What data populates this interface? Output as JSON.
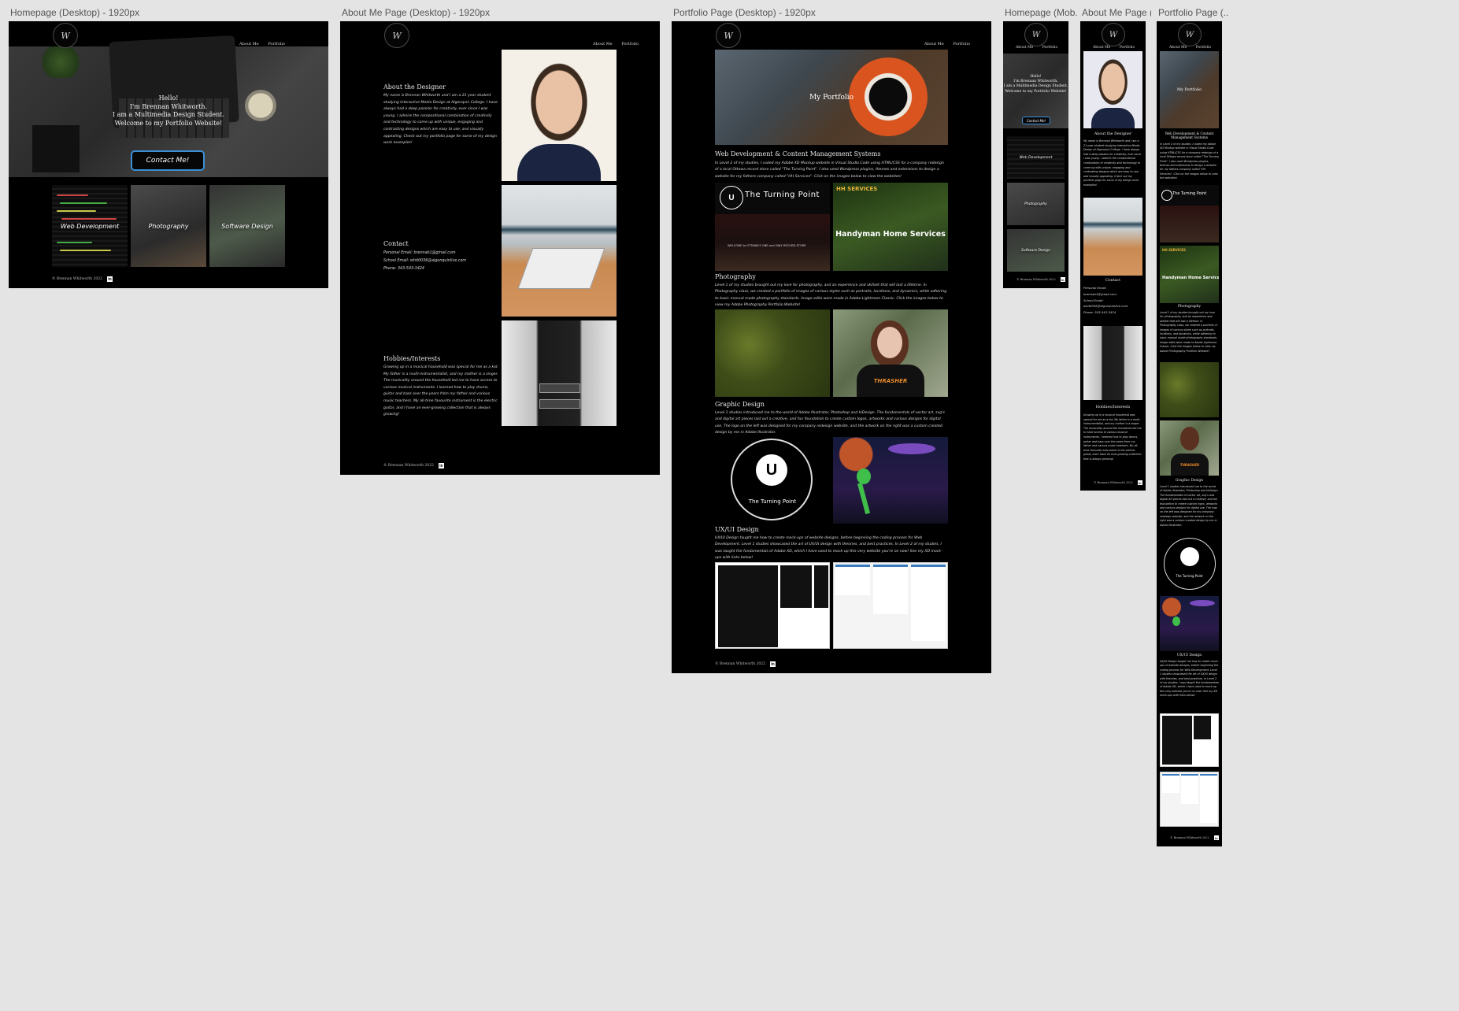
{
  "canvas": {
    "frames": [
      {
        "label": "Homepage (Desktop) - 1920px"
      },
      {
        "label": "About Me Page (Desktop) - 1920px"
      },
      {
        "label": "Portfolio Page (Desktop) - 1920px"
      },
      {
        "label": "Homepage (Mob..."
      },
      {
        "label": "About Me Page (..."
      },
      {
        "label": "Portfolio Page (..."
      }
    ]
  },
  "site": {
    "logo_text": "W",
    "nav": {
      "about": "About Me",
      "portfolio": "Portfolio"
    },
    "footer": {
      "copyright": "© Brennan Whitworth 2022",
      "linkedin": "in"
    }
  },
  "home": {
    "hero_lines": [
      "Hello!",
      "I'm Brennan Whitworth.",
      "I am a Multimedia Design Student.",
      "Welcome to my Portfolio Website!"
    ],
    "cta": "Contact Me!",
    "tiles": [
      "Web Development",
      "Photography",
      "Software Design"
    ]
  },
  "about": {
    "designer_title": "About the Designer",
    "designer_text": "My name is Brennan Whitworth and I am a 21-year student studying Interactive Media Design at Algonquin College. I have always had a deep passion for creativity, ever since I was young. I admire the compositional combination of creativity and technology to come up with unique, engaging and contrasting designs which are easy to use, and visually appealing. Check out my portfolio page for some of my design work examples!",
    "contact_title": "Contact",
    "contact_lines": [
      "Personal Email: brennab1@gmail.com",
      "School Email: whit0036@algonquinlive.com",
      "Phone: 343-543-3424"
    ],
    "hobbies_title": "Hobbies/Interests",
    "hobbies_text": "Growing up in a musical household was special for me as a kid. My father is a multi-instrumentalist, and my mother is a singer. The musicality around the household led me to have access to various musical instruments. I learned how to play drums, guitar and bass over the years from my father and various music teachers. My all-time favourite instrument is the electric guitar, and I have an ever-growing collection that is always growing!"
  },
  "portfolio": {
    "hero_title": "My Portfolio",
    "web_title": "Web Development & Content Management Systems",
    "web_text": "In Level 2 of my studies, I coded my Adobe XD Mockup website in Visual Studio Code using HTML/CSS for a company redesign of a local Ottawa record store called \"The Turning Point\". I also used Wordpress plugins, themes and extensions to design a website for my fathers company called \"HH Services\". Click on the images below to view the websites!",
    "turning_point": "The Turning Point",
    "tp_sub": "WELCOME to OTTAWA'S ONE and ONLY RECORD STORE",
    "hh_badge": "HH SERVICES",
    "hh_title": "Handyman Home Services",
    "photo_title": "Photography",
    "photo_text": "Level 1 of my studies brought out my love for photography, and an experience and skillset that will last a lifetime. In Photography class, we created a portfolio of images of various styles such as portraits, locations, and dynamics, while adhering to basic manual mode photography standards. Image edits were made in Adobe Lightroom Classic. Click the images below to view my Adobe Photography Portfolio Website!",
    "shirt_text": "THRASHER",
    "graphic_title": "Graphic Design",
    "graphic_text": "Level 1 studies introduced me to the world of Adobe Illustrator, Photoshop and InDesign. The fundamentals of vector art, svg's and digital art pieces laid out a creative, and fun foundation to create custom logos, artworks and various designs for digital use. The logo on the left was designed for my company redesign website, and the artwork on the right was a custom created design by me in Adobe Illustrator.",
    "ux_title": "UX/UI Design",
    "ux_text": "UX/UI Design taught me how to create mock-ups of website designs, before beginning the coding process for Web Development. Level 1 studies showcased the art of UX/UI design with theories, and best practices. In Level 2 of my studies, I was taught the fundamentals of Adobe XD, which I have used to mock-up this very website you're on now! See my XD mock-ups with links below!",
    "mobile_web_title": "Web Development & Content Management Systems"
  },
  "mobile_about": {
    "contact_lines": [
      "Personal Email:",
      "brennab1@gmail.com",
      "School Email:",
      "whit0036@algonquinlive.com",
      "Phone: 343-543-3424"
    ]
  },
  "colors": {
    "bg": "#000000",
    "canvas": "#e4e4e4",
    "cta_border": "#3a8fd6",
    "hh_green": "#2f4f1c"
  }
}
